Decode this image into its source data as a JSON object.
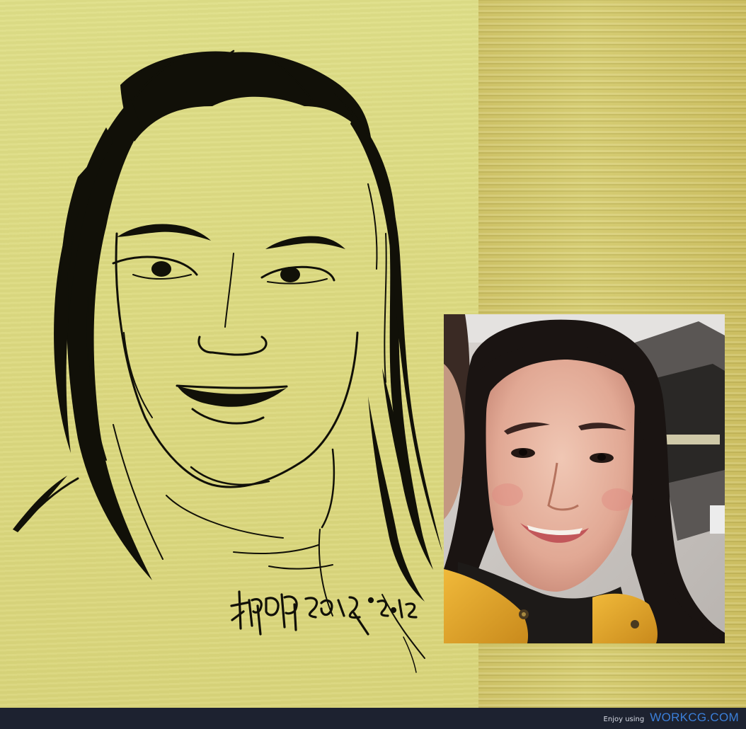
{
  "artwork": {
    "signature_text": "柳明明2016·2·12"
  },
  "footer": {
    "prefix": "Enjoy using",
    "brand": "WORKCG.COM"
  },
  "colors": {
    "canvas_yellow": "#dcd97f",
    "ink": "#111008",
    "footer_bg": "#1d2230",
    "brand_blue": "#3b7fd9",
    "jacket_yellow": "#e0a52a"
  }
}
